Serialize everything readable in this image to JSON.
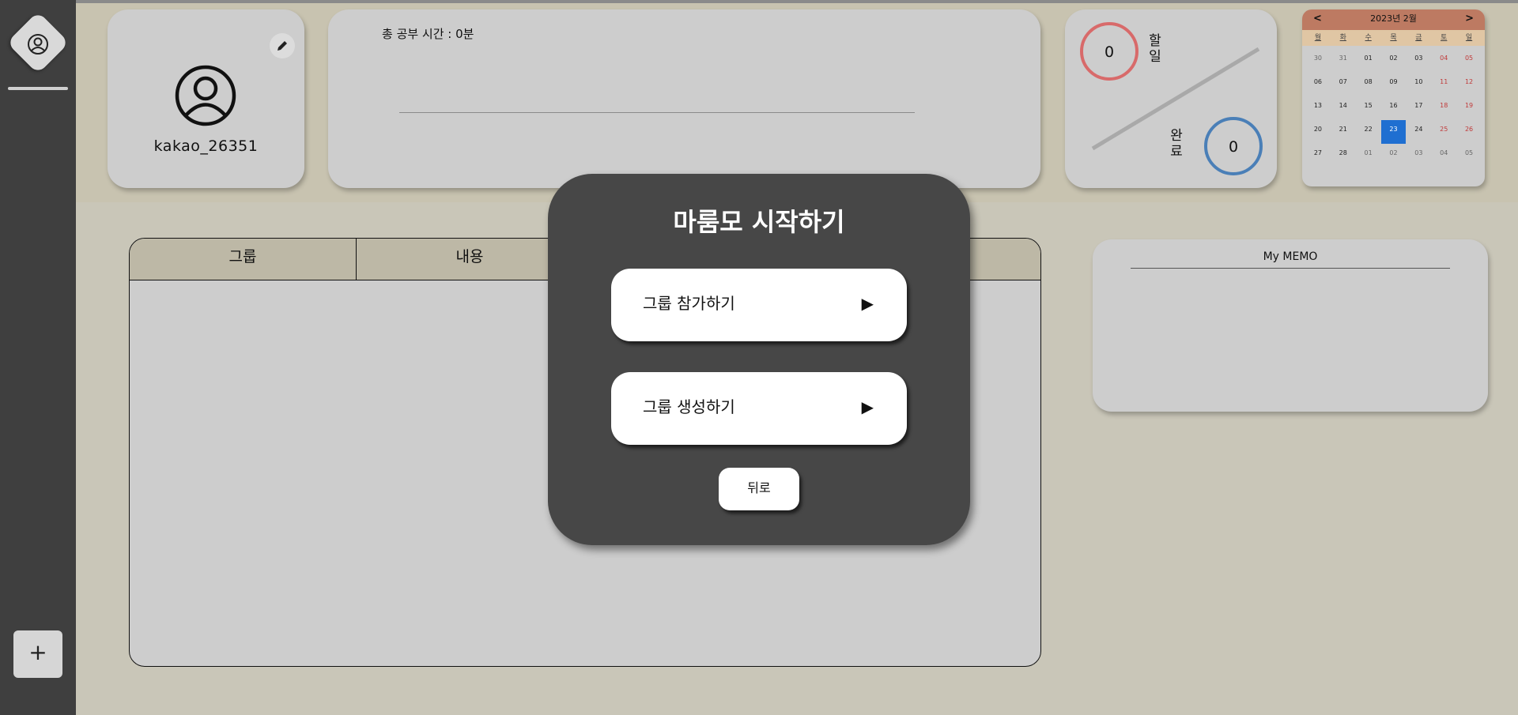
{
  "sidebar": {
    "logo_icon": "user-circle-icon",
    "add_label": "+"
  },
  "profile": {
    "username": "kakao_26351",
    "edit_icon": "pencil-icon",
    "avatar_icon": "user-circle-icon"
  },
  "study": {
    "total_label": "총 공부 시간 : 0분"
  },
  "todo": {
    "todo_count": "0",
    "todo_label": "할일",
    "done_count": "0",
    "done_label": "완료",
    "colors": {
      "todo": "#d86a6a",
      "done": "#4a7fb7"
    }
  },
  "calendar": {
    "prev": "<",
    "next": ">",
    "title": "2023년 2월",
    "weekdays": [
      "월",
      "화",
      "수",
      "목",
      "금",
      "토",
      "일"
    ],
    "days": [
      [
        "30",
        "31",
        "01",
        "02",
        "03",
        "04",
        "05"
      ],
      [
        "06",
        "07",
        "08",
        "09",
        "10",
        "11",
        "12"
      ],
      [
        "13",
        "14",
        "15",
        "16",
        "17",
        "18",
        "19"
      ],
      [
        "20",
        "21",
        "22",
        "23",
        "24",
        "25",
        "26"
      ],
      [
        "27",
        "28",
        "01",
        "02",
        "03",
        "04",
        "05"
      ]
    ],
    "today": "23",
    "colors": {
      "header": "#bd7a62",
      "weekday_bar": "#e0c6a4",
      "today": "#1f6fd1",
      "weekend": "#c03a3a"
    }
  },
  "group_table": {
    "columns": [
      "그룹",
      "내용",
      "",
      ""
    ]
  },
  "memo": {
    "title": "My MEMO"
  },
  "modal": {
    "title": "마룸모 시작하기",
    "join_label": "그룹 참가하기",
    "create_label": "그룹 생성하기",
    "arrow": "▶",
    "back_label": "뒤로"
  }
}
